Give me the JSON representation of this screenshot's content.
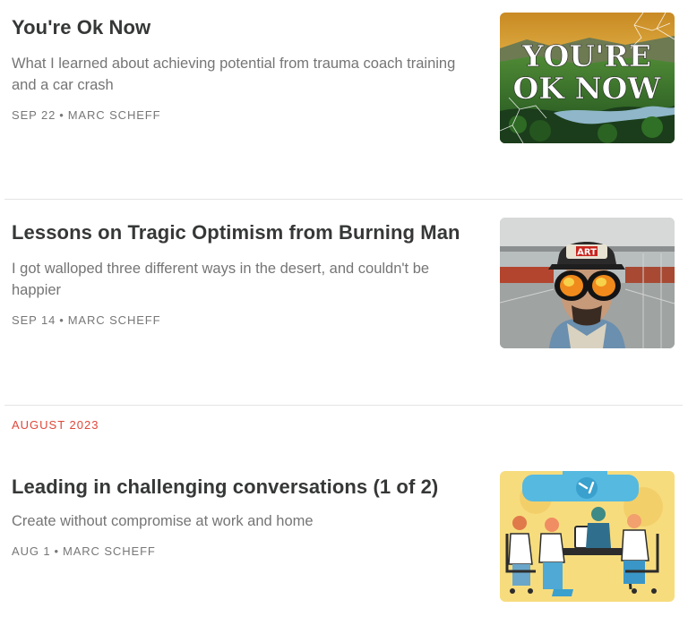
{
  "posts": [
    {
      "title": "You're Ok Now",
      "subtitle": "What I learned about achieving potential from trauma coach training and a car crash",
      "date": "SEP 22",
      "separator": "•",
      "author": "MARC SCHEFF",
      "image_text": [
        "YOU'RE",
        "OK NOW"
      ]
    },
    {
      "title": "Lessons on Tragic Optimism from Burning Man",
      "subtitle": "I got walloped three different ways in the desert, and couldn't be happier",
      "date": "SEP 14",
      "separator": "•",
      "author": "MARC SCHEFF",
      "image_text": [
        "ART"
      ]
    },
    {
      "title": "Leading in challenging conversations (1 of 2)",
      "subtitle": "Create without compromise at work and home",
      "date": "AUG 1",
      "separator": "•",
      "author": "MARC SCHEFF"
    }
  ],
  "section_label": "AUGUST 2023",
  "colors": {
    "title": "#363737",
    "subtitle": "#757575",
    "meta": "#777777",
    "section_accent": "#e0473a",
    "divider": "#e4e4e4"
  }
}
